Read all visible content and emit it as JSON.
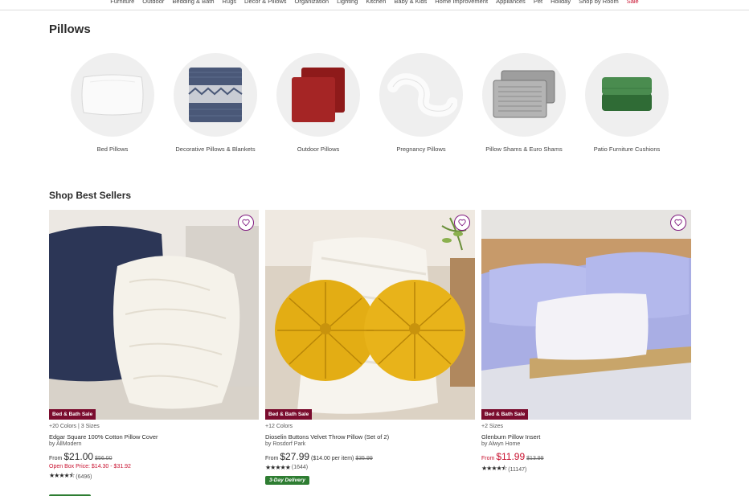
{
  "nav": {
    "items": [
      "Furniture",
      "Outdoor",
      "Bedding & Bath",
      "Rugs",
      "Decor & Pillows",
      "Organization",
      "Lighting",
      "Kitchen",
      "Baby & Kids",
      "Home Improvement",
      "Appliances",
      "Pet",
      "Holiday",
      "Shop by Room"
    ],
    "sale": "Sale"
  },
  "pillows": {
    "heading": "Pillows",
    "categories": [
      {
        "label": "Bed Pillows",
        "icon": "bed-pillow-image"
      },
      {
        "label": "Decorative Pillows & Blankets",
        "icon": "decorative-pillow-image"
      },
      {
        "label": "Outdoor Pillows",
        "icon": "outdoor-pillow-image"
      },
      {
        "label": "Pregnancy Pillows",
        "icon": "pregnancy-pillow-image"
      },
      {
        "label": "Pillow Shams & Euro Shams",
        "icon": "pillow-sham-image"
      },
      {
        "label": "Patio Furniture Cushions",
        "icon": "patio-cushion-image"
      }
    ]
  },
  "best_sellers": {
    "heading": "Shop Best Sellers",
    "products": [
      {
        "badge": "Bed & Bath Sale",
        "meta": "+20 Colors | 3 Sizes",
        "title": "Edgar Square 100% Cotton Pillow Cover",
        "by": "by AllModern",
        "from": "From",
        "price": "$21.00",
        "per_item": "",
        "was": "$56.00",
        "open_box": "Open Box Price: $14.30 - $31.92",
        "rating": 4.5,
        "reviews": "(6496)",
        "delivery": ""
      },
      {
        "badge": "Bed & Bath Sale",
        "meta": "+12 Colors",
        "title": "Dioselin Buttons Velvet Throw Pillow (Set of 2)",
        "by": "by Rosdorf Park",
        "from": "From",
        "price": "$27.99",
        "per_item": "($14.00 per item)",
        "was": "$35.99",
        "open_box": "",
        "rating": 5,
        "reviews": "(1644)",
        "delivery": "3-Day Delivery"
      },
      {
        "badge": "Bed & Bath Sale",
        "meta": "+2 Sizes",
        "title": "Glenburn Pillow Insert",
        "by": "by Alwyn Home",
        "from": "From",
        "price": "$11.99",
        "per_item": "",
        "was": "$13.99",
        "open_box": "",
        "rating": 4.5,
        "reviews": "(11147)",
        "delivery": ""
      }
    ]
  },
  "colors": {
    "accent_purple": "#7f187f",
    "sale_red": "#c8102e",
    "badge": "#7a0c2e",
    "delivery_green": "#2e7d32"
  }
}
